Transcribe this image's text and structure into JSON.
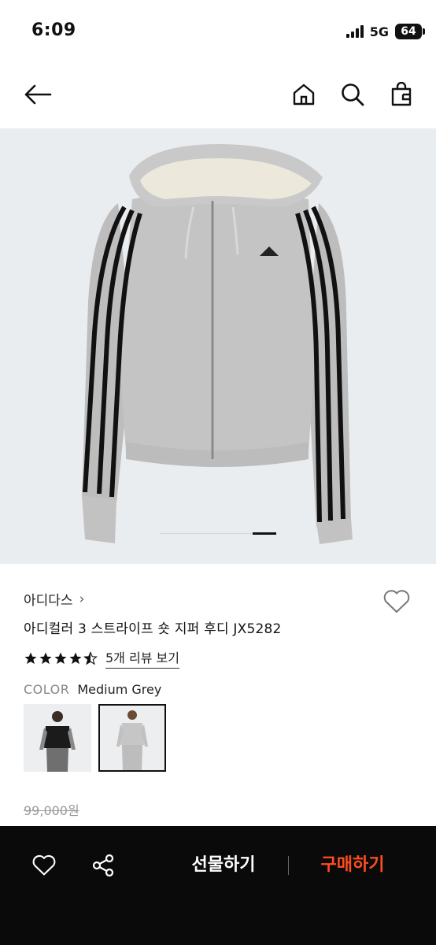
{
  "status": {
    "time": "6:09",
    "network": "5G",
    "battery": "64"
  },
  "nav": {
    "back_icon": "arrow-left-icon",
    "home_icon": "home-icon",
    "search_icon": "search-icon",
    "bag_icon": "shopping-bag-icon"
  },
  "gallery": {
    "slide_count": 5,
    "active_slide": 5
  },
  "product": {
    "brand": "아디다스",
    "brand_chevron": "›",
    "name": "아디컬러 3 스트라이프 숏 지퍼 후디 JX5282",
    "rating": 4.5,
    "review_label": "5개 리뷰 보기",
    "color_label": "COLOR",
    "color_value": "Medium Grey",
    "swatches": [
      {
        "name": "black-variant",
        "selected": false
      },
      {
        "name": "medium-grey-variant",
        "selected": true
      }
    ],
    "original_price": "99,000원"
  },
  "bottom_bar": {
    "gift_label": "선물하기",
    "buy_label": "구매하기",
    "buy_color": "#ff4d1f",
    "background": "#0a0a0a"
  }
}
